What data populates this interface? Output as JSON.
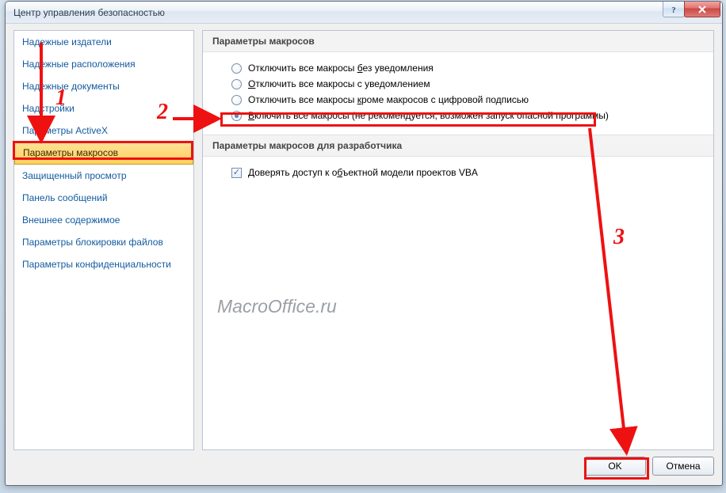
{
  "window": {
    "title": "Центр управления безопасностью"
  },
  "titlebar": {
    "help_tip": "?",
    "close_tip": "×"
  },
  "sidebar": {
    "items": [
      {
        "label": "Надежные издатели"
      },
      {
        "label": "Надежные расположения"
      },
      {
        "label": "Надежные документы"
      },
      {
        "label": "Надстройки"
      },
      {
        "label": "Параметры ActiveX"
      },
      {
        "label": "Параметры макросов"
      },
      {
        "label": "Защищенный просмотр"
      },
      {
        "label": "Панель сообщений"
      },
      {
        "label": "Внешнее содержимое"
      },
      {
        "label": "Параметры блокировки файлов"
      },
      {
        "label": "Параметры конфиденциальности"
      }
    ],
    "selected_index": 5
  },
  "groups": {
    "macro": {
      "title": "Параметры макросов",
      "options": [
        {
          "pre": "Отключить все макросы ",
          "accel": "б",
          "post": "ез уведомления"
        },
        {
          "pre": "",
          "accel": "О",
          "post": "тключить все макросы с уведомлением"
        },
        {
          "pre": "Отключить все макросы ",
          "accel": "к",
          "post": "роме макросов с цифровой подписью"
        },
        {
          "pre": "",
          "accel": "В",
          "post": "ключить все макросы (не рекомендуется, возможен запуск опасной программы)"
        }
      ],
      "selected_index": 3
    },
    "dev": {
      "title": "Параметры макросов для разработчика",
      "checkbox": {
        "checked": true,
        "pre": "Доверять доступ к о",
        "accel": "б",
        "post": "ъектной модели проектов VBA"
      }
    }
  },
  "footer": {
    "ok": "OK",
    "cancel": "Отмена"
  },
  "watermark": "MacroOffice.ru",
  "annotations": {
    "n1": "1",
    "n2": "2",
    "n3": "3"
  }
}
